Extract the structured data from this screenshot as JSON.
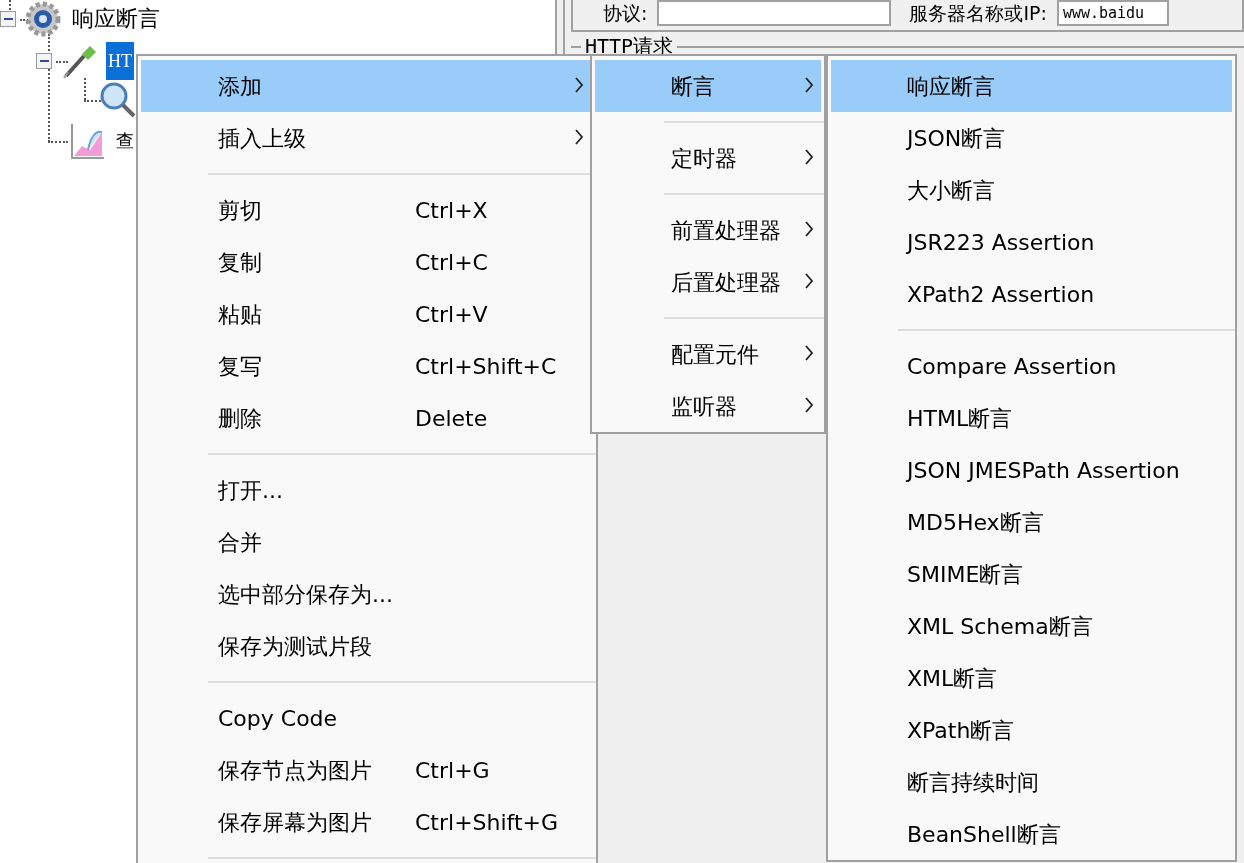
{
  "tree": [
    {
      "label": "响应断言",
      "kind": "controller",
      "selected": false,
      "expanded": true,
      "children": [
        {
          "label": "HT",
          "kind": "sampler",
          "selected": true,
          "expanded": true,
          "children": [
            {
              "kind": "assertion"
            }
          ]
        },
        {
          "label": "查",
          "kind": "listener",
          "selected": false
        }
      ]
    }
  ],
  "form": {
    "protocol_label": "协议:",
    "server_label": "服务器名称或IP:",
    "server_value": "www.baidu",
    "group_title": "HTTP请求"
  },
  "menus": [
    {
      "items": [
        {
          "kind": "item",
          "label": "添加",
          "submenu": true,
          "selected": true
        },
        {
          "kind": "item",
          "label": "插入上级",
          "submenu": true,
          "selected": false
        },
        {
          "kind": "separator"
        },
        {
          "kind": "item",
          "label": "剪切",
          "shortcut": "Ctrl+X",
          "selected": false
        },
        {
          "kind": "item",
          "label": "复制",
          "shortcut": "Ctrl+C",
          "selected": false
        },
        {
          "kind": "item",
          "label": "粘贴",
          "shortcut": "Ctrl+V",
          "selected": false
        },
        {
          "kind": "item",
          "label": "复写",
          "shortcut": "Ctrl+Shift+C",
          "selected": false
        },
        {
          "kind": "item",
          "label": "删除",
          "shortcut": "Delete",
          "selected": false
        },
        {
          "kind": "separator"
        },
        {
          "kind": "item",
          "label": "打开...",
          "selected": false
        },
        {
          "kind": "item",
          "label": "合并",
          "selected": false
        },
        {
          "kind": "item",
          "label": "选中部分保存为...",
          "selected": false
        },
        {
          "kind": "item",
          "label": "保存为测试片段",
          "selected": false
        },
        {
          "kind": "separator"
        },
        {
          "kind": "item",
          "label": "Copy Code",
          "selected": false
        },
        {
          "kind": "item",
          "label": "保存节点为图片",
          "shortcut": "Ctrl+G",
          "selected": false
        },
        {
          "kind": "item",
          "label": "保存屏幕为图片",
          "shortcut": "Ctrl+Shift+G",
          "selected": false
        },
        {
          "kind": "separator"
        }
      ]
    },
    {
      "items": [
        {
          "kind": "item",
          "label": "断言",
          "submenu": true,
          "selected": true
        },
        {
          "kind": "separator"
        },
        {
          "kind": "item",
          "label": "定时器",
          "submenu": true,
          "selected": false
        },
        {
          "kind": "separator"
        },
        {
          "kind": "item",
          "label": "前置处理器",
          "submenu": true,
          "selected": false
        },
        {
          "kind": "item",
          "label": "后置处理器",
          "submenu": true,
          "selected": false
        },
        {
          "kind": "separator"
        },
        {
          "kind": "item",
          "label": "配置元件",
          "submenu": true,
          "selected": false
        },
        {
          "kind": "item",
          "label": "监听器",
          "submenu": true,
          "selected": false
        }
      ]
    },
    {
      "items": [
        {
          "kind": "item",
          "label": "响应断言",
          "selected": true
        },
        {
          "kind": "item",
          "label": "JSON断言",
          "selected": false
        },
        {
          "kind": "item",
          "label": "大小断言",
          "selected": false
        },
        {
          "kind": "item",
          "label": "JSR223 Assertion",
          "selected": false
        },
        {
          "kind": "item",
          "label": "XPath2 Assertion",
          "selected": false
        },
        {
          "kind": "separator"
        },
        {
          "kind": "item",
          "label": "Compare Assertion",
          "selected": false
        },
        {
          "kind": "item",
          "label": "HTML断言",
          "selected": false
        },
        {
          "kind": "item",
          "label": "JSON JMESPath Assertion",
          "selected": false
        },
        {
          "kind": "item",
          "label": "MD5Hex断言",
          "selected": false
        },
        {
          "kind": "item",
          "label": "SMIME断言",
          "selected": false
        },
        {
          "kind": "item",
          "label": "XML Schema断言",
          "selected": false
        },
        {
          "kind": "item",
          "label": "XML断言",
          "selected": false
        },
        {
          "kind": "item",
          "label": "XPath断言",
          "selected": false
        },
        {
          "kind": "item",
          "label": "断言持续时间",
          "selected": false
        },
        {
          "kind": "item",
          "label": "BeanShell断言",
          "selected": false
        }
      ]
    }
  ]
}
